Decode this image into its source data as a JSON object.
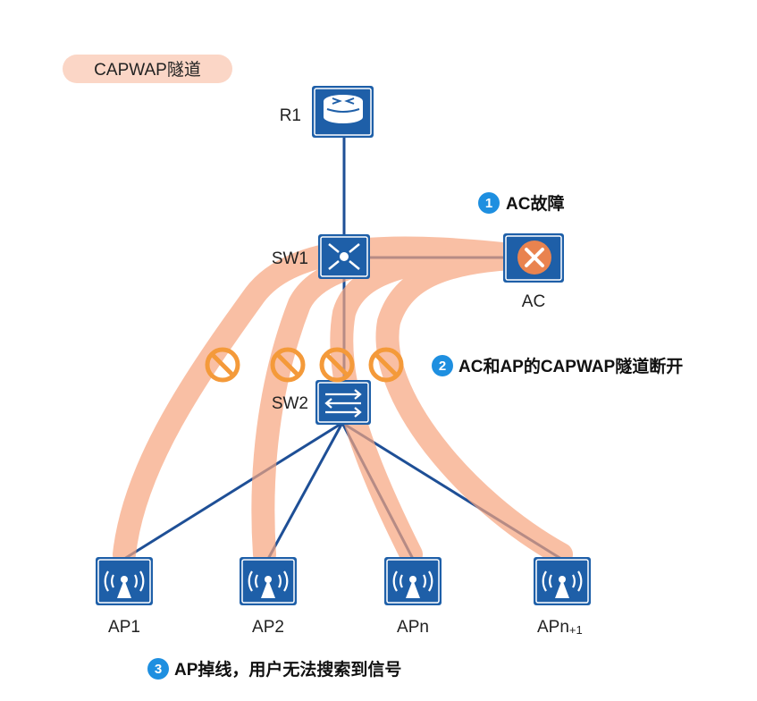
{
  "title": "CAPWAP隧道",
  "nodes": {
    "r1": "R1",
    "sw1": "SW1",
    "sw2": "SW2",
    "ac": "AC",
    "ap1": "AP1",
    "ap2": "AP2",
    "apn": "APn",
    "apn1_main": "APn",
    "apn1_sub": "+1"
  },
  "annotations": [
    {
      "num": "1",
      "text": "AC故障"
    },
    {
      "num": "2",
      "text": "AC和AP的CAPWAP隧道断开"
    },
    {
      "num": "3",
      "text": "AP掉线，用户无法搜索到信号"
    }
  ],
  "colors": {
    "device": "#1e5fa8",
    "link": "#1e4f96",
    "tunnel": "#f7a57e",
    "badge": "#1e8fe0",
    "block": "#f49a3a",
    "title_bg": "#fbd6c6"
  }
}
